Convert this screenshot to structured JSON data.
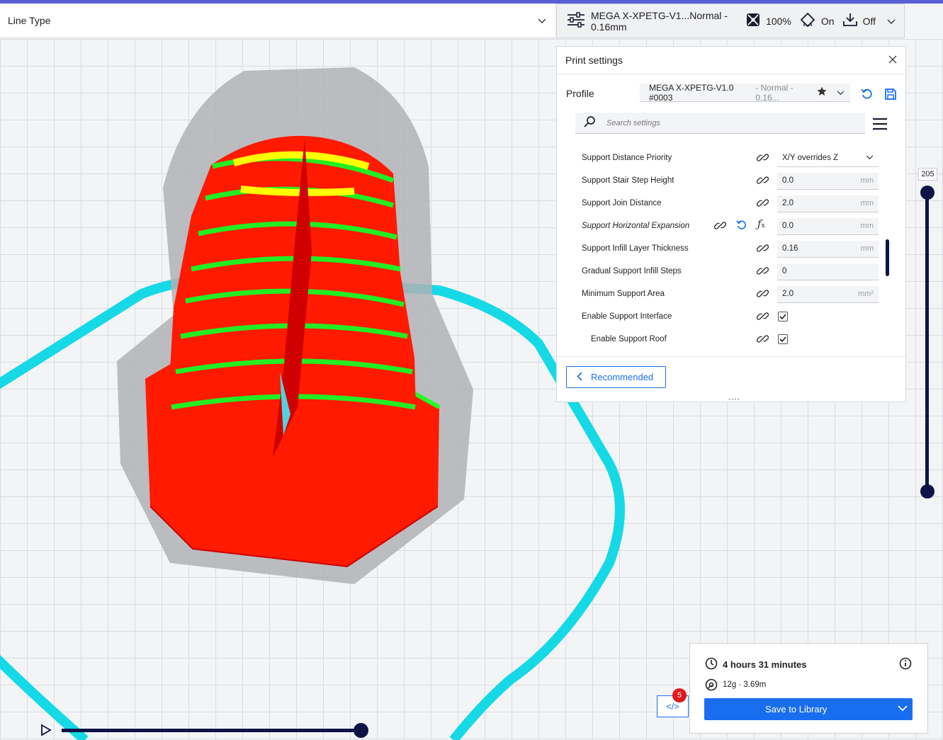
{
  "header": {
    "line_type_label": "Line Type",
    "print_profile_summary": "MEGA X-XPETG-V1...Normal - 0.16mm",
    "infill": "100%",
    "support": "On",
    "adhesion": "Off"
  },
  "print_settings": {
    "title": "Print settings",
    "profile_label": "Profile",
    "profile_name": "MEGA X-XPETG-V1.0 #0003",
    "profile_variant": " - Normal - 0.16...",
    "search_placeholder": "Search settings",
    "settings": [
      {
        "label": "Support Distance Priority",
        "value": "X/Y overrides Z",
        "type": "select"
      },
      {
        "label": "Support Stair Step Height",
        "value": "0.0",
        "unit": "mm",
        "type": "number"
      },
      {
        "label": "Support Join Distance",
        "value": "2.0",
        "unit": "mm",
        "type": "number"
      },
      {
        "label": "Support Horizontal Expansion",
        "value": "0.0",
        "unit": "mm",
        "type": "number"
      },
      {
        "label": "Support Infill Layer Thickness",
        "value": "0.16",
        "unit": "mm",
        "type": "number"
      },
      {
        "label": "Gradual Support Infill Steps",
        "value": "0",
        "type": "number"
      },
      {
        "label": "Minimum Support Area",
        "value": "2.0",
        "unit": "mm²",
        "type": "number"
      },
      {
        "label": "Enable Support Interface",
        "checked": true,
        "type": "checkbox"
      },
      {
        "label": "Enable Support Roof",
        "checked": true,
        "type": "checkbox"
      }
    ],
    "recommended_label": "Recommended"
  },
  "layer_slider": {
    "current_layer": "205",
    "min_fraction": 0.0,
    "max_fraction": 1.0
  },
  "playback": {
    "progress_fraction": 1.0
  },
  "notifications": {
    "count": "5"
  },
  "estimate": {
    "time": "4 hours 31 minutes",
    "material": "12g · 3.69m",
    "save_label": "Save to Library"
  },
  "colors": {
    "accent": "#196ef0",
    "slider": "#0e1445",
    "wall_outer": "#ff0000",
    "wall_inner": "#00ff00",
    "top_bottom": "#ffff00",
    "skirt": "#00e5ee",
    "badge": "#e1181c"
  }
}
